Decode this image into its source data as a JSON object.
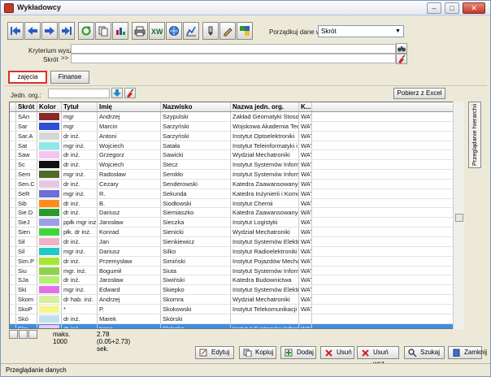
{
  "window": {
    "title": "Wykładowcy",
    "min": "–",
    "max": "□",
    "close": "✕"
  },
  "sort": {
    "label": "Porządkuj dane wg:",
    "value": "Skrót",
    "arrow": "▼"
  },
  "criteria": {
    "label1": "Kryterium wyszuk.",
    "label2": "Skrót",
    "marker": ">>"
  },
  "tabs": {
    "zajecia": "zajęcia",
    "finanse": "Finanse"
  },
  "unit": {
    "label": "Jedn. org.:"
  },
  "pobierz_label": "Pobierz z Excel",
  "side_tab_label": "Przeglądanie hierarchii",
  "columns": [
    "Skrót",
    "Kolor",
    "Tytuł",
    "Imię",
    "Nazwisko",
    "Nazwa jedn. org.",
    "K..."
  ],
  "rows": [
    {
      "skrot": "SAn",
      "color": "#8b2a2a",
      "tytul": "mgr",
      "imie": "Andrzej",
      "nazwisko": "Szypulski",
      "jedn": "Zakład Geomatyki Stosow",
      "k": "WAT"
    },
    {
      "skrot": "Sar",
      "color": "#2f4fd6",
      "tytul": "mgr",
      "imie": "Marcin",
      "nazwisko": "Sarzyński",
      "jedn": "Wojskowa Akademia Tec",
      "k": "WAT"
    },
    {
      "skrot": "Sar.A",
      "color": "#d6d6d6",
      "tytul": "dr inż.",
      "imie": "Antoni",
      "nazwisko": "Sarzyński",
      "jedn": "Instytut Optoelektroniki",
      "k": "WAT"
    },
    {
      "skrot": "Sat",
      "color": "#8fe8e8",
      "tytul": "mgr inż.",
      "imie": "Wojciech",
      "nazwisko": "Satała",
      "jedn": "Instytut Teleinformatyki i A",
      "k": "WAT"
    },
    {
      "skrot": "Saw",
      "color": "#f2c6f2",
      "tytul": "dr inż.",
      "imie": "Grzegorz",
      "nazwisko": "Sawicki",
      "jedn": "Wydział Mechatroniki",
      "k": "WAT"
    },
    {
      "skrot": "Sc",
      "color": "#111111",
      "tytul": "dr inż.",
      "imie": "Wojciech",
      "nazwisko": "Stecz",
      "jedn": "Instytut Systemów Inform",
      "k": "WAT"
    },
    {
      "skrot": "Sem",
      "color": "#4e6b2a",
      "tytul": "mgr inż.",
      "imie": "Radosław",
      "nazwisko": "Semkło",
      "jedn": "Instytut Systemów Inform",
      "k": "WAT"
    },
    {
      "skrot": "Sen.C",
      "color": "#e6c6e6",
      "tytul": "dr inż.",
      "imie": "Cezary",
      "nazwisko": "Senderowski",
      "jedn": "Katedra Zaawansowanyc",
      "k": "WAT"
    },
    {
      "skrot": "SeR",
      "color": "#6e6ed6",
      "tytul": "mgr inż.",
      "imie": "R.",
      "nazwisko": "Sekunda",
      "jedn": "Katedra Inżynierii i Komur",
      "k": "WAT"
    },
    {
      "skrot": "Sib",
      "color": "#ff8c1a",
      "tytul": "dr inż.",
      "imie": "B.",
      "nazwisko": "Siodłowski",
      "jedn": "Instytut Chemii",
      "k": "WAT"
    },
    {
      "skrot": "Sie.D",
      "color": "#2a9a2a",
      "tytul": "dr inż.",
      "imie": "Dariusz",
      "nazwisko": "Siemiaszko",
      "jedn": "Katedra Zaawansowanyc",
      "k": "WAT"
    },
    {
      "skrot": "SieJ",
      "color": "#9e9ee6",
      "tytul": "ppłk mgr inż.",
      "imie": "Jarosław",
      "nazwisko": "Sieczka",
      "jedn": "Instytut Logistyki",
      "k": "WAT"
    },
    {
      "skrot": "Sien",
      "color": "#3cd63c",
      "tytul": "płk. dr inż.",
      "imie": "Konrad",
      "nazwisko": "Sienicki",
      "jedn": "Wydział Mechatroniki",
      "k": "WAT"
    },
    {
      "skrot": "Sił",
      "color": "#f0b0c8",
      "tytul": "dr inż.",
      "imie": "Jan",
      "nazwisko": "Sienkiewicz",
      "jedn": "Instytut Systemów Elektr",
      "k": "WAT"
    },
    {
      "skrot": "Sil",
      "color": "#20c8c8",
      "tytul": "mgr inż.",
      "imie": "Dariusz",
      "nazwisko": "Silko",
      "jedn": "Instytut Radioelektroniki",
      "k": "WAT"
    },
    {
      "skrot": "Sim.P",
      "color": "#a8e630",
      "tytul": "dr inż.",
      "imie": "Przemysław",
      "nazwisko": "Simiński",
      "jedn": "Instytut Pojazdów Mecha",
      "k": "WAT"
    },
    {
      "skrot": "Siu",
      "color": "#8ed24a",
      "tytul": "mgr. inż.",
      "imie": "Bogumił",
      "nazwisko": "Siuta",
      "jedn": "Instytut Systemów Inform",
      "k": "WAT"
    },
    {
      "skrot": "SJa",
      "color": "#b6f070",
      "tytul": "dr inż.",
      "imie": "Jarosław",
      "nazwisko": "Siwiński",
      "jedn": "Katedra Budownictwa",
      "k": "WAT"
    },
    {
      "skrot": "Ski",
      "color": "#e670e6",
      "tytul": "mgr inż.",
      "imie": "Edward",
      "nazwisko": "Skiepko",
      "jedn": "Instytut Systemów Elektr",
      "k": "WAT"
    },
    {
      "skrot": "Skom",
      "color": "#d6f0a0",
      "tytul": "dr hab. inż.",
      "imie": "Andrzej",
      "nazwisko": "Skomra",
      "jedn": "Wydział Mechatroniki",
      "k": "WAT"
    },
    {
      "skrot": "SkoP",
      "color": "#f6f690",
      "tytul": "*",
      "imie": "P.",
      "nazwisko": "Skokowski",
      "jedn": "Instytut Telekomunikacji",
      "k": "WAT"
    },
    {
      "skrot": "Skó",
      "color": "#c0e0f0",
      "tytul": "dr inż.",
      "imie": "Marek",
      "nazwisko": "Skórski",
      "jedn": "",
      "k": ""
    },
    {
      "skrot": "Skr",
      "color": "#f0c8f0",
      "tytul": "dr inż.",
      "imie": "Irena",
      "nazwisko": "Skórska",
      "jedn": "Instytut Systemów Inform",
      "k": "WAT"
    }
  ],
  "status": {
    "max": "maks. 1000",
    "time": "2.78 (0.05+2.73) sek."
  },
  "actions": {
    "edit": "Edytuj",
    "copy": "Kopiuj",
    "add": "Dodaj",
    "delete": "Usuń",
    "delete_all": "Usuń wsz.",
    "search": "Szukaj",
    "close": "Zamknij"
  },
  "statusbar": "Przeglądanie danych"
}
